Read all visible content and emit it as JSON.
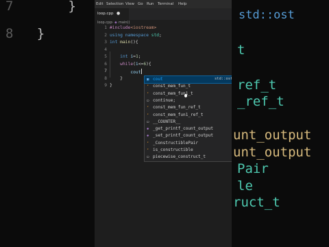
{
  "menu": [
    "Edit",
    "Selection",
    "View",
    "Go",
    "Run",
    "Terminal",
    "Help"
  ],
  "tab": {
    "filename": "loop.cpp",
    "modified_dot": "●"
  },
  "breadcrumb": {
    "file": "loop.cpp",
    "separator": "›",
    "symbol_icon": "function-icon",
    "symbol": "main()"
  },
  "code": {
    "lines": [
      {
        "n": "1",
        "parts": [
          [
            "kw-pp",
            "#include"
          ],
          [
            "str",
            "<iostream>"
          ]
        ]
      },
      {
        "n": "2",
        "parts": [
          [
            "kw-b",
            "using namespace "
          ],
          [
            "ty",
            "std"
          ],
          [
            "",
            "; "
          ]
        ]
      },
      {
        "n": "3",
        "parts": [
          [
            "kw-b",
            "int "
          ],
          [
            "fn-y",
            "main"
          ],
          [
            "",
            "(){"
          ]
        ]
      },
      {
        "n": "4",
        "parts": []
      },
      {
        "n": "5",
        "parts": [
          [
            "",
            "    "
          ],
          [
            "kw-b",
            "int "
          ],
          [
            "var",
            "i"
          ],
          [
            "",
            "="
          ],
          [
            "num-g",
            "1"
          ],
          [
            "",
            ";"
          ]
        ]
      },
      {
        "n": "6",
        "parts": [
          [
            "",
            "    "
          ],
          [
            "kw-pp",
            "while"
          ],
          [
            "",
            "("
          ],
          [
            "var",
            "i"
          ],
          [
            "",
            "<="
          ],
          [
            "num-g",
            "6"
          ],
          [
            "",
            ")"
          ],
          [
            "",
            "{"
          ]
        ]
      },
      {
        "n": "7",
        "parts": [
          [
            "",
            "        "
          ],
          [
            "var",
            "cout"
          ]
        ]
      },
      {
        "n": "8",
        "parts": [
          [
            "",
            "    "
          ],
          [
            "",
            "}"
          ]
        ]
      },
      {
        "n": "9",
        "parts": [
          [
            "",
            "}"
          ]
        ]
      }
    ]
  },
  "suggestions": [
    {
      "label": "cout",
      "hl": "cout",
      "icon": "variable-icon",
      "detail": "std::ost",
      "selected": true
    },
    {
      "label": "const_mem_fun_t",
      "icon": "class-icon"
    },
    {
      "label": "const_mem_fun1_t",
      "icon": "class-icon"
    },
    {
      "label": "continue;",
      "icon": "snippet-icon"
    },
    {
      "label": "const_mem_fun_ref_t",
      "icon": "class-icon"
    },
    {
      "label": "const_mem_fun1_ref_t",
      "icon": "class-icon"
    },
    {
      "label": "__COUNTER__",
      "icon": "constant-icon"
    },
    {
      "label": "_get_printf_count_output",
      "icon": "function-icon"
    },
    {
      "label": "_set_printf_count_output",
      "icon": "function-icon"
    },
    {
      "label": "_ConstructiblePair",
      "icon": "class-icon"
    },
    {
      "label": "is_constructible",
      "icon": "class-icon"
    },
    {
      "label": "piecewise_construct_t",
      "icon": "snippet-icon"
    }
  ],
  "background_left": [
    {
      "num": "7",
      "text": "    }"
    },
    {
      "num": "8",
      "text": "}"
    }
  ],
  "background_right": [
    "std::ost",
    "t",
    "ref_t",
    "_ref_t",
    "",
    "unt_output",
    "unt_output",
    "Pair",
    "le",
    "ruct_t"
  ]
}
